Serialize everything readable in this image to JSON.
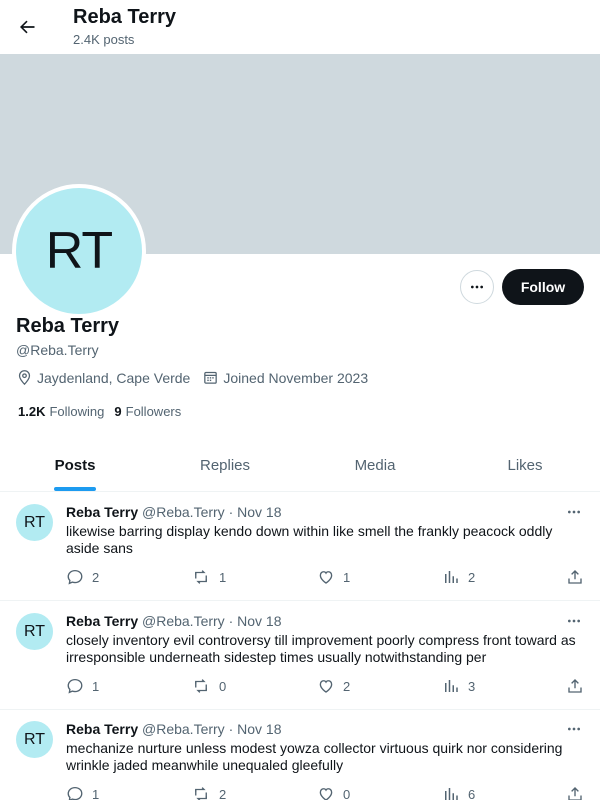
{
  "header": {
    "title": "Reba Terry",
    "posts_count": "2.4K posts",
    "back_icon": "arrow-left-icon"
  },
  "profile": {
    "avatar_initials": "RT",
    "name": "Reba Terry",
    "handle": "@Reba.Terry",
    "location": "Jaydenland, Cape Verde",
    "joined": "Joined November 2023",
    "following_count": "1.2K",
    "following_label": "Following",
    "followers_count": "9",
    "followers_label": "Followers",
    "follow_label": "Follow",
    "banner_color": "#cfd9de",
    "avatar_color": "#b2ebf2"
  },
  "tabs": [
    {
      "label": "Posts",
      "active": true
    },
    {
      "label": "Replies",
      "active": false
    },
    {
      "label": "Media",
      "active": false
    },
    {
      "label": "Likes",
      "active": false
    }
  ],
  "posts": [
    {
      "avatar": "RT",
      "name": "Reba Terry",
      "handle": "@Reba.Terry",
      "date": "Nov 18",
      "text": "likewise barring display kendo down within like smell the frankly peacock oddly aside sans",
      "replies": "2",
      "reposts": "1",
      "likes": "1",
      "views": "2"
    },
    {
      "avatar": "RT",
      "name": "Reba Terry",
      "handle": "@Reba.Terry",
      "date": "Nov 18",
      "text": "closely inventory evil controversy till improvement poorly compress front toward as irresponsible underneath sidestep times usually notwithstanding per",
      "replies": "1",
      "reposts": "0",
      "likes": "2",
      "views": "3"
    },
    {
      "avatar": "RT",
      "name": "Reba Terry",
      "handle": "@Reba.Terry",
      "date": "Nov 18",
      "text": "mechanize nurture unless modest yowza collector virtuous quirk nor considering wrinkle jaded meanwhile unequaled gleefully",
      "replies": "1",
      "reposts": "2",
      "likes": "0",
      "views": "6"
    }
  ],
  "colors": {
    "accent": "#1d9bf0",
    "text": "#0f1419",
    "muted": "#536471"
  }
}
